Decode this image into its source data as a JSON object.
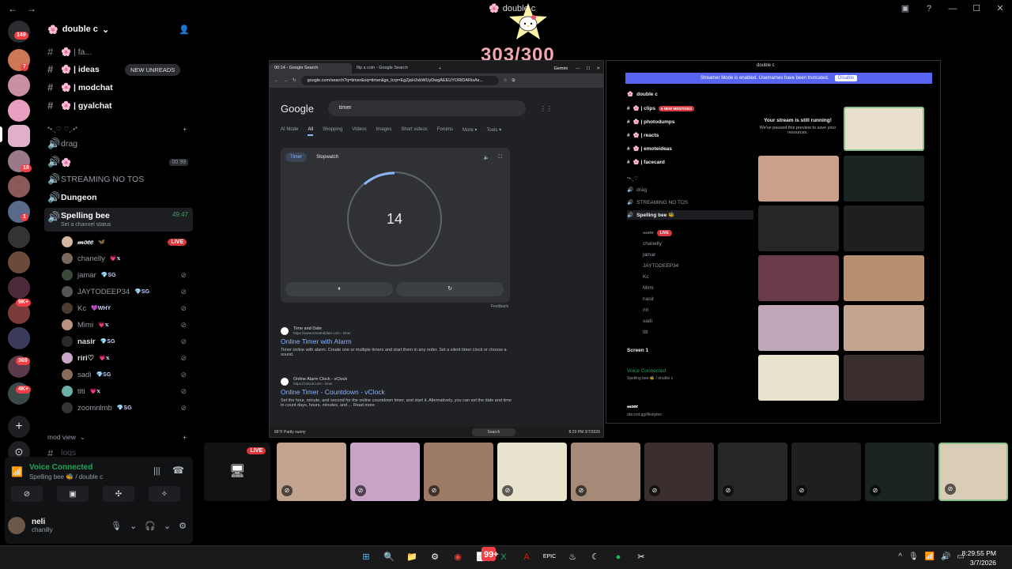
{
  "window": {
    "title": "double c",
    "nav_back": "←",
    "nav_fwd": "→",
    "controls": [
      "▣",
      "?",
      "—",
      "☐",
      "✕"
    ]
  },
  "rail": {
    "badges": [
      "149",
      "7",
      "1",
      "18",
      "1",
      "1",
      "369",
      "4K+",
      "9K+"
    ]
  },
  "guild": {
    "name": "double c",
    "new_unreads": "NEW UNREADS"
  },
  "channels": [
    {
      "icon": "#",
      "name": "🌸 | fa...",
      "kind": "text"
    },
    {
      "icon": "#",
      "name": "🌸 | ideas",
      "kind": "text-bright"
    },
    {
      "icon": "#",
      "name": "🌸 | modchat",
      "kind": "text-bright"
    },
    {
      "icon": "#",
      "name": "🌸 | gyalchat",
      "kind": "text-bright"
    },
    {
      "icon": "",
      "name": "*•.¸♡ ♡¸.•*",
      "kind": "category"
    },
    {
      "icon": "🔊",
      "name": "drag",
      "kind": "voice"
    },
    {
      "icon": "🔊",
      "name": "🌸",
      "kind": "voice"
    },
    {
      "icon": "🔊",
      "name": "STREAMING NO TOS",
      "kind": "voice"
    },
    {
      "icon": "🔊",
      "name": "Dungeon",
      "kind": "voice-bright"
    }
  ],
  "emoji_counter": {
    "a": "00",
    "b": "99"
  },
  "active_voice": {
    "name": "Spelling bee",
    "time": "49:47",
    "status_hint": "Set a channel status"
  },
  "members": [
    {
      "name": "𝓂𝑜𝑒𝑒",
      "tag": "",
      "live": "LIVE",
      "color": "#d4b7a0"
    },
    {
      "name": "chanelly",
      "tag": "💗𝕩",
      "live": "",
      "color": "#7a6a5e"
    },
    {
      "name": "jamar",
      "tag": "💎SG",
      "live": "",
      "color": "#3a4a3a"
    },
    {
      "name": "JAYTODEEP34",
      "tag": "💎SG",
      "live": "",
      "color": "#555"
    },
    {
      "name": "Kc",
      "tag": "💜WHY",
      "live": "",
      "color": "#4a3a30"
    },
    {
      "name": "Mimi",
      "tag": "💗𝕩",
      "live": "",
      "color": "#b89480"
    },
    {
      "name": "nasir",
      "tag": "💎SG",
      "live": "",
      "color": "#2a2a2a"
    },
    {
      "name": "riri♡",
      "tag": "💗𝕩",
      "live": "",
      "color": "#c9a8c9"
    },
    {
      "name": "sadi",
      "tag": "💎SG",
      "live": "",
      "color": "#8a6a5a"
    },
    {
      "name": "titi",
      "tag": "💗𝕩",
      "live": "",
      "color": "#6ab0a8"
    },
    {
      "name": "zoomnlmb",
      "tag": "💎SG",
      "live": "",
      "color": "#333"
    }
  ],
  "lower_channels": {
    "mod_view": "mod view",
    "logs": "logs"
  },
  "voice_panel": {
    "connected": "Voice Connected",
    "location": "Spelling bee 🐝 / double c"
  },
  "user": {
    "display": "neli",
    "username": "chanilly"
  },
  "counter": "303/300",
  "browser": {
    "tab1": "00:14 - Google Search",
    "tab2": "flip a coin - Google Search",
    "url": "google.com/search?q=timer&oq=timer&gs_lcrp=EgZjaHJvbWUyDwgAEEUYORiDARixAx...",
    "gemini": "Gemini",
    "logo": "Google",
    "query": "timer",
    "nav": [
      "AI Mode",
      "All",
      "Shopping",
      "Videos",
      "Images",
      "Short videos",
      "Forums",
      "More ▾",
      "Tools ▾"
    ],
    "timer_tab": "Timer",
    "stopwatch_tab": "Stopwatch",
    "timer_value": "14",
    "pause_glyph": "⏸",
    "reset_glyph": "↻",
    "feedback": "Feedback",
    "results": [
      {
        "site": "Time and Date",
        "url": "https://www.timeanddate.com › timer",
        "title": "Online Timer with Alarm",
        "snippet": "Timer online with alarm. Create one or multiple timers and start them in any order. Set a silent timer clock or choose a sound."
      },
      {
        "site": "Online Alarm Clock - vClock",
        "url": "https://vclock.com › timer",
        "title": "Online Timer - Countdown - vClock",
        "snippet": "Set the hour, minute, and second for the online countdown timer, and start it. Alternatively, you can set the date and time to count days, hours, minutes, and ... Read more"
      }
    ],
    "weather": "86°F Partly sunny",
    "search_label": "Search",
    "mini_clock": "8:29 PM 3/7/2026"
  },
  "dwin": {
    "title": "double c",
    "streamer_mode": "Streamer Mode is enabled. Usernames have been truncated.",
    "disable": "Disable",
    "guild": "double c",
    "channels": [
      "🌸 | clips",
      "🌸 | photodumps",
      "🌸 | reacts",
      "🌸 | emoteideas",
      "🌸 | facecard"
    ],
    "mentions": "6 NEW MENTIONS",
    "category": "*•.¸♡",
    "voice": [
      "drag",
      "STREAMING NO TOS",
      "Spelling bee 🐝"
    ],
    "members": [
      "𝓂𝑜𝑒𝑒",
      "chanelly",
      "jamar",
      "JAYTODEEP34",
      "Kc",
      "Mimi",
      "nasir",
      "riri",
      "sadi",
      "titi"
    ],
    "paused_title": "Your stream is still running!",
    "paused_sub": "We've paused this preview to save your resources.",
    "live": "LIVE",
    "screen": "Screen 1",
    "voice_connected": "Voice Connected",
    "voice_loc": "Spelling bee 🐝 / double c",
    "user": "𝓂𝑜𝑒𝑒",
    "user_sub": "discord.gg/lifestyleo"
  },
  "strip": {
    "live": "LIVE",
    "tiles": [
      "#c2a38f",
      "#c8a3c8",
      "#9c7a66",
      "#e8e3cc",
      "#a58a78",
      "#3a2e2e",
      "#262626",
      "#1f1f1f",
      "#1a2422",
      "#d9cdb8"
    ]
  },
  "taskbar": {
    "time": "8:29:55 PM",
    "date": "3/7/2026",
    "icons": [
      "windows-start",
      "search",
      "file-explorer",
      "settings-gear",
      "chrome",
      "notepad",
      "excel",
      "acrobat",
      "epic-games",
      "steam",
      "edge",
      "spotify",
      "capcut"
    ],
    "notepad_badge": "99+"
  },
  "colors": {
    "accent": "#5865f2",
    "online": "#23a55a",
    "live": "#da373c",
    "counter": "#f2a6b4"
  }
}
